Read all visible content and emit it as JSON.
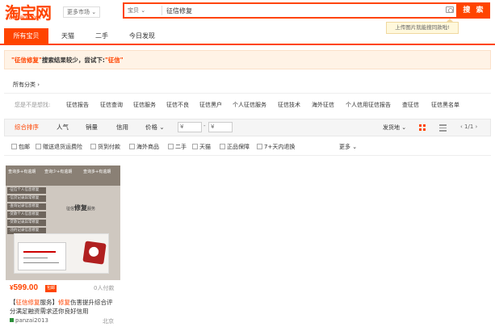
{
  "header": {
    "logo_cn": "淘宝网",
    "logo_en": "Taobao.com",
    "more_market": "更多市场",
    "search_category": "宝贝",
    "search_query": "征信修复",
    "search_button": "搜 索",
    "tooltip": "上传图片就能搜同款啦!"
  },
  "nav": {
    "tabs": [
      "所有宝贝",
      "天猫",
      "二手",
      "今日发现"
    ]
  },
  "notice": {
    "quoted": "\"征信修复\"",
    "text": "搜索结果较少，尝试下:",
    "suggestion": "\"征信\""
  },
  "breadcrumb": "所有分类",
  "suggestions": {
    "label": "您是不是想找:",
    "items": [
      "征信报告",
      "征信查询",
      "征信服务",
      "征信不良",
      "征信黑户",
      "个人征信服务",
      "征信技术",
      "海外征信",
      "个人信用征信报告",
      "查征信",
      "征信黑名单"
    ]
  },
  "sortbar": {
    "tabs": [
      "综合排序",
      "人气",
      "销量",
      "信用",
      "价格"
    ],
    "price_from": "¥",
    "price_to": "¥",
    "ship_from": "发货地",
    "page": "1/1"
  },
  "filters": {
    "items": [
      "包邮",
      "赠送退货运费险",
      "货到付款",
      "海外商品",
      "二手",
      "天猫",
      "正品保障",
      "7+天内退换"
    ],
    "more": "更多"
  },
  "product": {
    "thumb_top_left": "查询多+有逾期",
    "thumb_top_right": "查询少+有逾期",
    "thumb_top_right2": "查询多+有逾期",
    "thumb_menu": [
      "·征信个人信息修复",
      "·信贷记录异常修复",
      "·查询记录信息修复",
      "·贷款个人信息修复",
      "·贷款记录异常修复",
      "·违约记录信息修复"
    ],
    "thumb_big_prefix": "征信",
    "thumb_big_main": "修复",
    "thumb_big_suffix": "服务",
    "price": "599.00",
    "currency": "¥",
    "price_badge": "包邮",
    "paid": "0人付款",
    "title_line1_pre": "【",
    "title_line1_hl1": "征信修复",
    "title_line1_mid": "服务】",
    "title_line1_hl2": "修复",
    "title_line1_post": "伤害提升综合评",
    "title_line2": "分满足融资需求还你良好信用",
    "shop": "panzai2013",
    "location": "北京"
  }
}
